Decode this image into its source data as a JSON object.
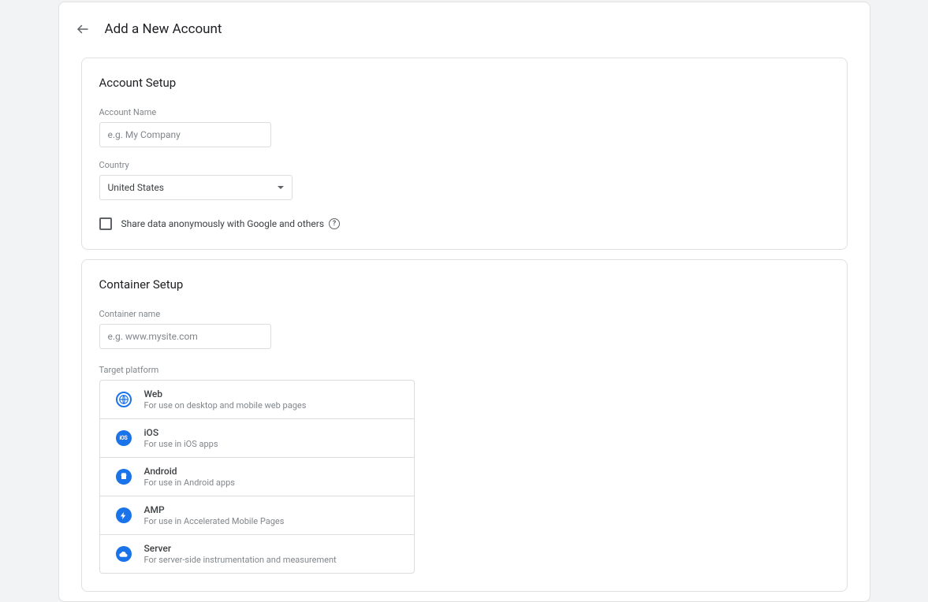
{
  "page": {
    "title": "Add a New Account"
  },
  "account": {
    "section_title": "Account Setup",
    "name_label": "Account Name",
    "name_placeholder": "e.g. My Company",
    "name_value": "",
    "country_label": "Country",
    "country_value": "United States",
    "share_label": "Share data anonymously with Google and others",
    "share_checked": false
  },
  "container": {
    "section_title": "Container Setup",
    "name_label": "Container name",
    "name_placeholder": "e.g. www.mysite.com",
    "name_value": "",
    "platform_label": "Target platform",
    "platforms": [
      {
        "icon": "web",
        "name": "Web",
        "desc": "For use on desktop and mobile web pages"
      },
      {
        "icon": "ios",
        "name": "iOS",
        "desc": "For use in iOS apps"
      },
      {
        "icon": "android",
        "name": "Android",
        "desc": "For use in Android apps"
      },
      {
        "icon": "amp",
        "name": "AMP",
        "desc": "For use in Accelerated Mobile Pages"
      },
      {
        "icon": "server",
        "name": "Server",
        "desc": "For server-side instrumentation and measurement"
      }
    ]
  },
  "colors": {
    "accent": "#1a73e8",
    "border": "#dadce0",
    "muted": "#80868b"
  }
}
